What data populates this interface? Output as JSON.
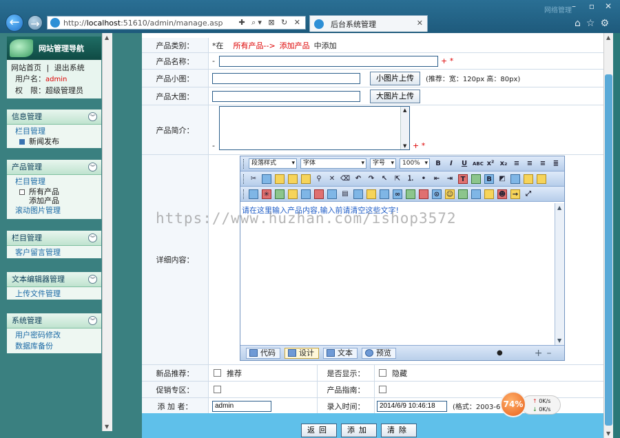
{
  "browser": {
    "url_prefix": "http://",
    "url_host": "localhost",
    "url_rest": ":51610/admin/manage.asp",
    "tab_title": "后台系统管理",
    "win_title": "网络管理"
  },
  "sidebar": {
    "title": "网站管理导航",
    "home_link": "网站首页",
    "sep": "|",
    "logout_link": "退出系统",
    "username_label": "用户名：",
    "username": "admin",
    "role_label": "权　限：",
    "role": "超级管理员",
    "groups": [
      {
        "title": "信息管理",
        "items": [
          "栏目管理"
        ],
        "subs": [
          "新闻发布"
        ]
      },
      {
        "title": "产品管理",
        "items": [
          "栏目管理"
        ],
        "subs": [
          "所有产品",
          "添加产品"
        ],
        "extra": "滚动图片管理"
      },
      {
        "title": "栏目管理",
        "items": [
          "客户留言管理"
        ]
      },
      {
        "title": "文本编辑器管理",
        "items": [
          "上传文件管理"
        ]
      },
      {
        "title": "系统管理",
        "items": [
          "用户密码修改",
          "数据库备份"
        ]
      }
    ]
  },
  "form": {
    "category_label": "产品类别：",
    "category_prefix": "*在",
    "category_all": "所有产品-->",
    "category_add": "添加产品",
    "category_suffix": "中添加",
    "name_label": "产品名称：",
    "dash": "-",
    "plus_star": "+ *",
    "small_img_label": "产品小图：",
    "small_img_btn": "小图片上传",
    "small_img_hint": "(推荐：宽：120px 高：80px)",
    "big_img_label": "产品大图：",
    "big_img_btn": "大图片上传",
    "intro_label": "产品简介：",
    "detail_label": "详细内容：",
    "editor": {
      "para_style": "段落样式",
      "font": "字体",
      "size": "字号",
      "zoom": "100%",
      "placeholder": "请在这里输入产品内容,输入前请清空这些文字!",
      "mode_code": "代码",
      "mode_design": "设计",
      "mode_text": "文本",
      "mode_preview": "预览"
    },
    "recommend_label": "新品推荐：",
    "recommend_opt": "推荐",
    "show_label": "是否显示：",
    "show_opt": "隐藏",
    "promo_label": "促销专区：",
    "guide_label": "产品指南：",
    "adder_label": "添 加 者：",
    "adder_value": "admin",
    "time_label": "录入时间：",
    "time_value": "2014/6/9 10:46:18",
    "time_hint": "(格式：2003-6-",
    "btn_back": "返回",
    "btn_add": "添加",
    "btn_clear": "清除"
  },
  "watermark": "https://www.huzhan.com/ishop3572",
  "speed": {
    "percent": "74%",
    "up": "0K/s",
    "down": "0K/s"
  }
}
